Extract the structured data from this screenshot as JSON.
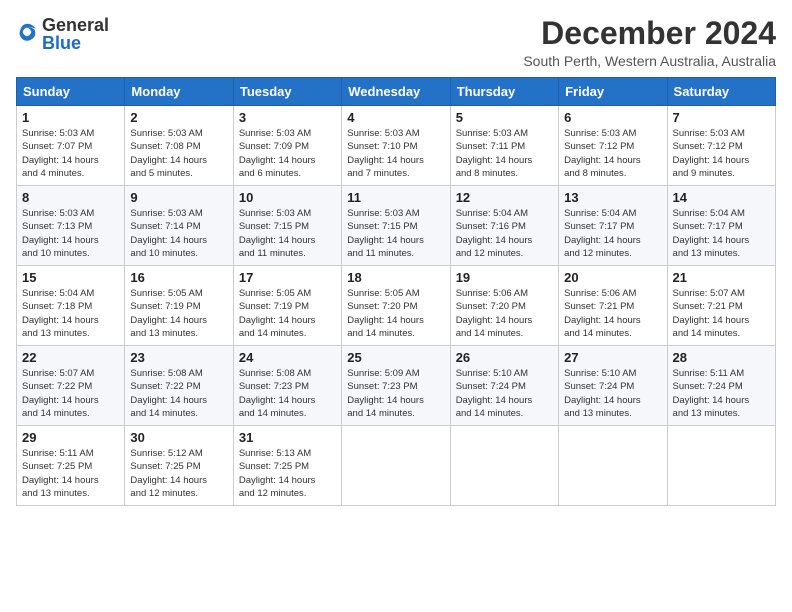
{
  "logo": {
    "text_general": "General",
    "text_blue": "Blue"
  },
  "title": "December 2024",
  "location": "South Perth, Western Australia, Australia",
  "days_of_week": [
    "Sunday",
    "Monday",
    "Tuesday",
    "Wednesday",
    "Thursday",
    "Friday",
    "Saturday"
  ],
  "weeks": [
    [
      {
        "day": "1",
        "info": "Sunrise: 5:03 AM\nSunset: 7:07 PM\nDaylight: 14 hours\nand 4 minutes."
      },
      {
        "day": "2",
        "info": "Sunrise: 5:03 AM\nSunset: 7:08 PM\nDaylight: 14 hours\nand 5 minutes."
      },
      {
        "day": "3",
        "info": "Sunrise: 5:03 AM\nSunset: 7:09 PM\nDaylight: 14 hours\nand 6 minutes."
      },
      {
        "day": "4",
        "info": "Sunrise: 5:03 AM\nSunset: 7:10 PM\nDaylight: 14 hours\nand 7 minutes."
      },
      {
        "day": "5",
        "info": "Sunrise: 5:03 AM\nSunset: 7:11 PM\nDaylight: 14 hours\nand 8 minutes."
      },
      {
        "day": "6",
        "info": "Sunrise: 5:03 AM\nSunset: 7:12 PM\nDaylight: 14 hours\nand 8 minutes."
      },
      {
        "day": "7",
        "info": "Sunrise: 5:03 AM\nSunset: 7:12 PM\nDaylight: 14 hours\nand 9 minutes."
      }
    ],
    [
      {
        "day": "8",
        "info": "Sunrise: 5:03 AM\nSunset: 7:13 PM\nDaylight: 14 hours\nand 10 minutes."
      },
      {
        "day": "9",
        "info": "Sunrise: 5:03 AM\nSunset: 7:14 PM\nDaylight: 14 hours\nand 10 minutes."
      },
      {
        "day": "10",
        "info": "Sunrise: 5:03 AM\nSunset: 7:15 PM\nDaylight: 14 hours\nand 11 minutes."
      },
      {
        "day": "11",
        "info": "Sunrise: 5:03 AM\nSunset: 7:15 PM\nDaylight: 14 hours\nand 11 minutes."
      },
      {
        "day": "12",
        "info": "Sunrise: 5:04 AM\nSunset: 7:16 PM\nDaylight: 14 hours\nand 12 minutes."
      },
      {
        "day": "13",
        "info": "Sunrise: 5:04 AM\nSunset: 7:17 PM\nDaylight: 14 hours\nand 12 minutes."
      },
      {
        "day": "14",
        "info": "Sunrise: 5:04 AM\nSunset: 7:17 PM\nDaylight: 14 hours\nand 13 minutes."
      }
    ],
    [
      {
        "day": "15",
        "info": "Sunrise: 5:04 AM\nSunset: 7:18 PM\nDaylight: 14 hours\nand 13 minutes."
      },
      {
        "day": "16",
        "info": "Sunrise: 5:05 AM\nSunset: 7:19 PM\nDaylight: 14 hours\nand 13 minutes."
      },
      {
        "day": "17",
        "info": "Sunrise: 5:05 AM\nSunset: 7:19 PM\nDaylight: 14 hours\nand 14 minutes."
      },
      {
        "day": "18",
        "info": "Sunrise: 5:05 AM\nSunset: 7:20 PM\nDaylight: 14 hours\nand 14 minutes."
      },
      {
        "day": "19",
        "info": "Sunrise: 5:06 AM\nSunset: 7:20 PM\nDaylight: 14 hours\nand 14 minutes."
      },
      {
        "day": "20",
        "info": "Sunrise: 5:06 AM\nSunset: 7:21 PM\nDaylight: 14 hours\nand 14 minutes."
      },
      {
        "day": "21",
        "info": "Sunrise: 5:07 AM\nSunset: 7:21 PM\nDaylight: 14 hours\nand 14 minutes."
      }
    ],
    [
      {
        "day": "22",
        "info": "Sunrise: 5:07 AM\nSunset: 7:22 PM\nDaylight: 14 hours\nand 14 minutes."
      },
      {
        "day": "23",
        "info": "Sunrise: 5:08 AM\nSunset: 7:22 PM\nDaylight: 14 hours\nand 14 minutes."
      },
      {
        "day": "24",
        "info": "Sunrise: 5:08 AM\nSunset: 7:23 PM\nDaylight: 14 hours\nand 14 minutes."
      },
      {
        "day": "25",
        "info": "Sunrise: 5:09 AM\nSunset: 7:23 PM\nDaylight: 14 hours\nand 14 minutes."
      },
      {
        "day": "26",
        "info": "Sunrise: 5:10 AM\nSunset: 7:24 PM\nDaylight: 14 hours\nand 14 minutes."
      },
      {
        "day": "27",
        "info": "Sunrise: 5:10 AM\nSunset: 7:24 PM\nDaylight: 14 hours\nand 13 minutes."
      },
      {
        "day": "28",
        "info": "Sunrise: 5:11 AM\nSunset: 7:24 PM\nDaylight: 14 hours\nand 13 minutes."
      }
    ],
    [
      {
        "day": "29",
        "info": "Sunrise: 5:11 AM\nSunset: 7:25 PM\nDaylight: 14 hours\nand 13 minutes."
      },
      {
        "day": "30",
        "info": "Sunrise: 5:12 AM\nSunset: 7:25 PM\nDaylight: 14 hours\nand 12 minutes."
      },
      {
        "day": "31",
        "info": "Sunrise: 5:13 AM\nSunset: 7:25 PM\nDaylight: 14 hours\nand 12 minutes."
      },
      null,
      null,
      null,
      null
    ]
  ]
}
